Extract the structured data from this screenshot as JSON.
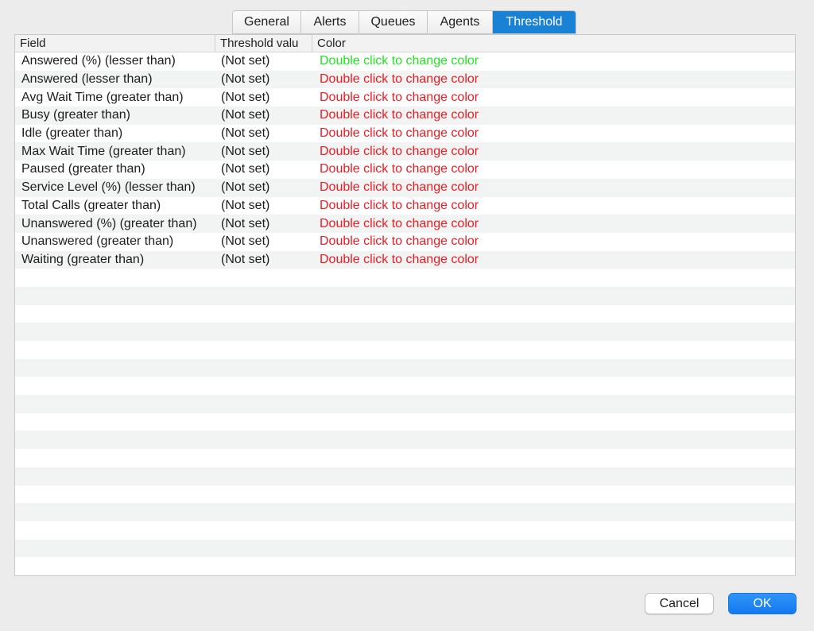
{
  "tabs": [
    {
      "label": "General",
      "active": false
    },
    {
      "label": "Alerts",
      "active": false
    },
    {
      "label": "Queues",
      "active": false
    },
    {
      "label": "Agents",
      "active": false
    },
    {
      "label": "Threshold",
      "active": true
    }
  ],
  "table": {
    "columns": [
      "Field",
      "Threshold valu",
      "Color"
    ],
    "rows": [
      {
        "field": "Answered (%) (lesser than)",
        "threshold": "(Not set)",
        "color_text": "Double click to change color",
        "color": "#1ee81e"
      },
      {
        "field": "Answered (lesser than)",
        "threshold": "(Not set)",
        "color_text": "Double click to change color",
        "color": "#ec1c24"
      },
      {
        "field": "Avg Wait Time (greater than)",
        "threshold": "(Not set)",
        "color_text": "Double click to change color",
        "color": "#ec1c24"
      },
      {
        "field": "Busy (greater than)",
        "threshold": "(Not set)",
        "color_text": "Double click to change color",
        "color": "#ec1c24"
      },
      {
        "field": "Idle (greater than)",
        "threshold": "(Not set)",
        "color_text": "Double click to change color",
        "color": "#ec1c24"
      },
      {
        "field": "Max Wait Time (greater than)",
        "threshold": "(Not set)",
        "color_text": "Double click to change color",
        "color": "#ec1c24"
      },
      {
        "field": "Paused (greater than)",
        "threshold": "(Not set)",
        "color_text": "Double click to change color",
        "color": "#ec1c24"
      },
      {
        "field": "Service Level (%) (lesser than)",
        "threshold": "(Not set)",
        "color_text": "Double click to change color",
        "color": "#ec1c24"
      },
      {
        "field": "Total Calls (greater than)",
        "threshold": "(Not set)",
        "color_text": "Double click to change color",
        "color": "#ec1c24"
      },
      {
        "field": "Unanswered (%) (greater than)",
        "threshold": "(Not set)",
        "color_text": "Double click to change color",
        "color": "#ec1c24"
      },
      {
        "field": "Unanswered (greater than)",
        "threshold": "(Not set)",
        "color_text": "Double click to change color",
        "color": "#ec1c24"
      },
      {
        "field": "Waiting (greater than)",
        "threshold": "(Not set)",
        "color_text": "Double click to change color",
        "color": "#ec1c24"
      }
    ]
  },
  "buttons": {
    "cancel_label": "Cancel",
    "ok_label": "OK"
  },
  "colors": {
    "accent": "#1a82d4",
    "ok_button": "#1479f0"
  }
}
